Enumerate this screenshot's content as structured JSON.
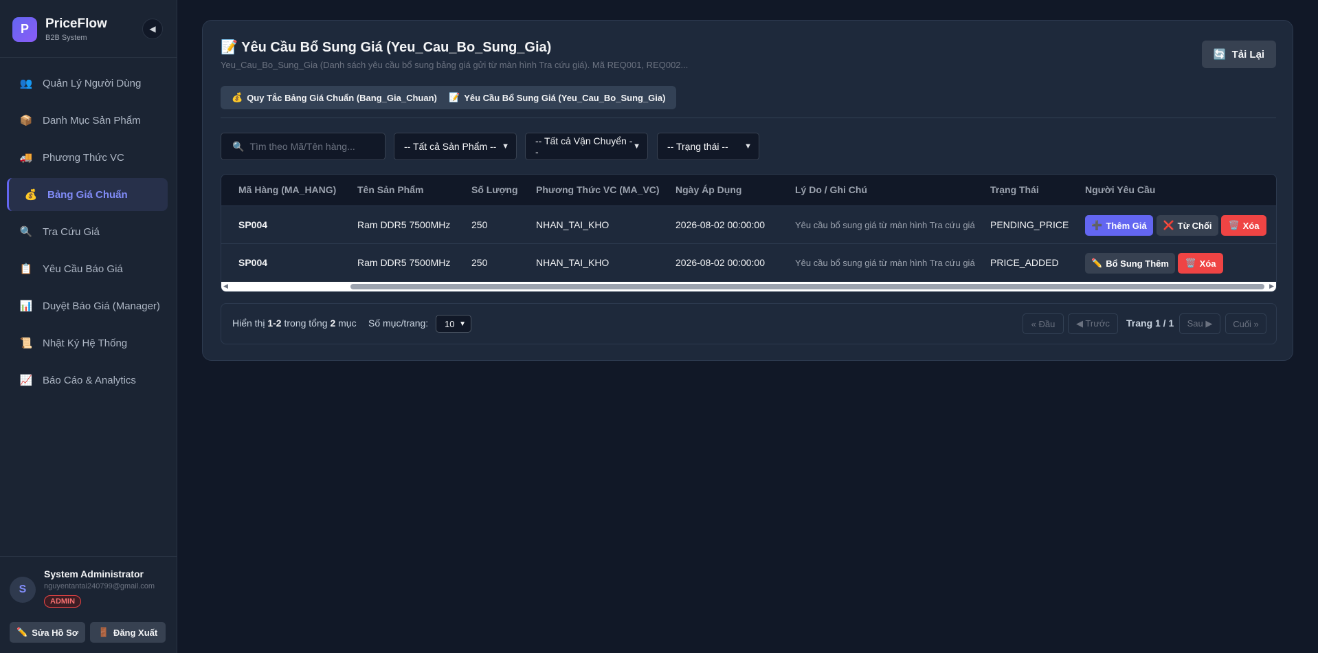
{
  "brand": {
    "logo": "P",
    "title": "PriceFlow",
    "subtitle": "B2B System",
    "collapse_icon": "◀"
  },
  "sidebar": {
    "items": [
      {
        "icon": "👥",
        "icon_name": "users-icon",
        "label": "Quản Lý Người Dùng"
      },
      {
        "icon": "📦",
        "icon_name": "package-icon",
        "label": "Danh Mục Sản Phẩm"
      },
      {
        "icon": "🚚",
        "icon_name": "truck-icon",
        "label": "Phương Thức VC"
      },
      {
        "icon": "💰",
        "icon_name": "money-bag-icon",
        "label": "Bảng Giá Chuẩn",
        "active": true
      },
      {
        "icon": "🔍",
        "icon_name": "search-icon",
        "label": "Tra Cứu Giá"
      },
      {
        "icon": "📋",
        "icon_name": "clipboard-icon",
        "label": "Yêu Cầu Báo Giá"
      },
      {
        "icon": "📊",
        "icon_name": "bar-chart-icon",
        "label": "Duyệt Báo Giá (Manager)"
      },
      {
        "icon": "📜",
        "icon_name": "scroll-icon",
        "label": "Nhật Ký Hệ Thống"
      },
      {
        "icon": "📈",
        "icon_name": "trend-chart-icon",
        "label": "Báo Cáo & Analytics"
      }
    ]
  },
  "user": {
    "initial": "S",
    "name": "System Administrator",
    "email": "nguyentantai240799@gmail.com",
    "role": "ADMIN",
    "edit_profile_icon": "✏️",
    "edit_profile": "Sửa Hồ Sơ",
    "logout_icon": "🚪",
    "logout": "Đăng Xuất"
  },
  "page": {
    "title_icon": "📝",
    "title": "Yêu Cầu Bổ Sung Giá (Yeu_Cau_Bo_Sung_Gia)",
    "description": "Yeu_Cau_Bo_Sung_Gia (Danh sách yêu cầu bổ sung bảng giá gửi từ màn hình Tra cứu giá). Mã REQ001, REQ002...",
    "reload_icon": "🔄",
    "reload": "Tải Lại"
  },
  "tabs": [
    {
      "icon": "💰",
      "label": "Quy Tắc Bảng Giá Chuẩn (Bang_Gia_Chuan)"
    },
    {
      "icon": "📝",
      "label": "Yêu Cầu Bổ Sung Giá (Yeu_Cau_Bo_Sung_Gia)",
      "active": true
    }
  ],
  "filters": {
    "search_icon": "🔍",
    "search_placeholder": "Tìm theo Mã/Tên hàng...",
    "product": "-- Tất cả Sản Phẩm --",
    "shipping": "-- Tất cả Vận Chuyển --",
    "status": "-- Trạng thái --"
  },
  "table": {
    "headers": [
      "Mã Hàng (MA_HANG)",
      "Tên Sản Phẩm",
      "Số Lượng",
      "Phương Thức VC (MA_VC)",
      "Ngày Áp Dụng",
      "Lý Do / Ghi Chú",
      "Trạng Thái",
      "Người Yêu Cầu"
    ],
    "rows": [
      {
        "code": "SP004",
        "product": "Ram DDR5 7500MHz",
        "qty": "250",
        "shipping": "NHAN_TAI_KHO",
        "date": "2026-08-02 00:00:00",
        "note": "Yêu cầu bổ sung giá từ màn hình Tra cứu giá",
        "status": "PENDING_PRICE",
        "actions": [
          {
            "icon": "➕",
            "label": "Thêm Giá",
            "style": "indigo"
          },
          {
            "icon": "❌",
            "label": "Từ Chối",
            "style": "gray"
          },
          {
            "icon": "🗑️",
            "label": "Xóa",
            "style": "red"
          }
        ]
      },
      {
        "code": "SP004",
        "product": "Ram DDR5 7500MHz",
        "qty": "250",
        "shipping": "NHAN_TAI_KHO",
        "date": "2026-08-02 00:00:00",
        "note": "Yêu cầu bổ sung giá từ màn hình Tra cứu giá",
        "status": "PRICE_ADDED",
        "actions": [
          {
            "icon": "✏️",
            "label": "Bổ Sung Thêm",
            "style": "gray"
          },
          {
            "icon": "🗑️",
            "label": "Xóa",
            "style": "red"
          }
        ]
      }
    ]
  },
  "pagination": {
    "showing_prefix": "Hiển thị",
    "range": "1-2",
    "total_prefix": "trong tổng",
    "total": "2",
    "unit": "mục",
    "per_page_label": "Số mục/trang:",
    "per_page": "10",
    "first": "« Đầu",
    "prev": "◀ Trước",
    "page": "Trang 1 / 1",
    "next": "Sau ▶",
    "last": "Cuối »"
  },
  "colors": {
    "accent": "#6366f1",
    "danger": "#ef4444",
    "background": "#111827",
    "card": "#1e293b"
  }
}
